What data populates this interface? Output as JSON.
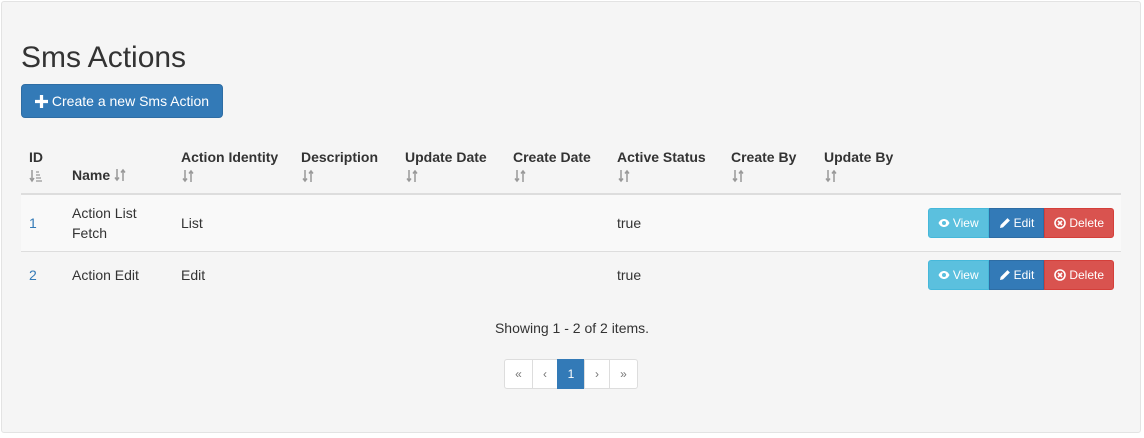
{
  "page": {
    "title": "Sms Actions"
  },
  "create_button": {
    "label": "Create a new Sms Action"
  },
  "table": {
    "headers": {
      "id": "ID",
      "name": "Name",
      "action_identity": "Action Identity",
      "description": "Description",
      "update_date": "Update Date",
      "create_date": "Create Date",
      "active_status": "Active Status",
      "create_by": "Create By",
      "update_by": "Update By"
    },
    "rows": [
      {
        "id": "1",
        "name": "Action List Fetch",
        "action_identity": "List",
        "description": "",
        "update_date": "",
        "create_date": "",
        "active_status": "true",
        "create_by": "",
        "update_by": ""
      },
      {
        "id": "2",
        "name": "Action Edit",
        "action_identity": "Edit",
        "description": "",
        "update_date": "",
        "create_date": "",
        "active_status": "true",
        "create_by": "",
        "update_by": ""
      }
    ],
    "row_actions": {
      "view": "View",
      "edit": "Edit",
      "delete": "Delete"
    }
  },
  "summary": "Showing 1 - 2 of 2 items.",
  "pagination": {
    "first": "«",
    "prev": "‹",
    "current": "1",
    "next": "›",
    "last": "»"
  },
  "colors": {
    "primary": "#337ab7",
    "info": "#5bc0de",
    "danger": "#d9534f",
    "panel_bg": "#f5f5f5"
  }
}
